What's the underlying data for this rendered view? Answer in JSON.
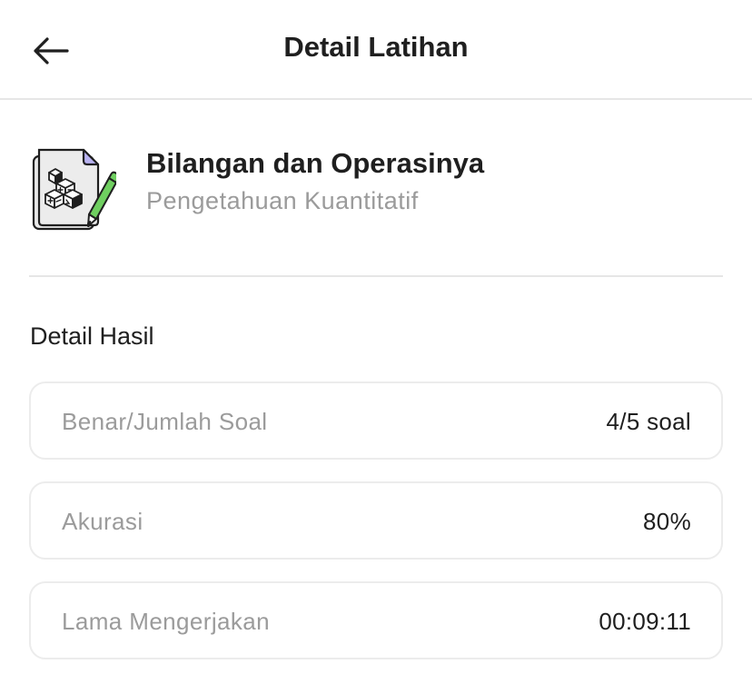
{
  "header": {
    "title": "Detail Latihan",
    "back_icon": "arrow-left-icon"
  },
  "topic": {
    "icon": "math-blocks-pencil-icon",
    "title": "Bilangan dan Operasinya",
    "subtitle": "Pengetahuan Kuantitatif"
  },
  "results": {
    "section_title": "Detail Hasil",
    "items": [
      {
        "label": "Benar/Jumlah Soal",
        "value": "4/5 soal"
      },
      {
        "label": "Akurasi",
        "value": "80%"
      },
      {
        "label": "Lama Mengerjakan",
        "value": "00:09:11"
      }
    ]
  },
  "colors": {
    "text_primary": "#1f1f1f",
    "text_secondary": "#9b9b9b",
    "border": "#e6e6e6",
    "accent_green": "#6fcf60",
    "accent_purple": "#b8b2f0"
  }
}
